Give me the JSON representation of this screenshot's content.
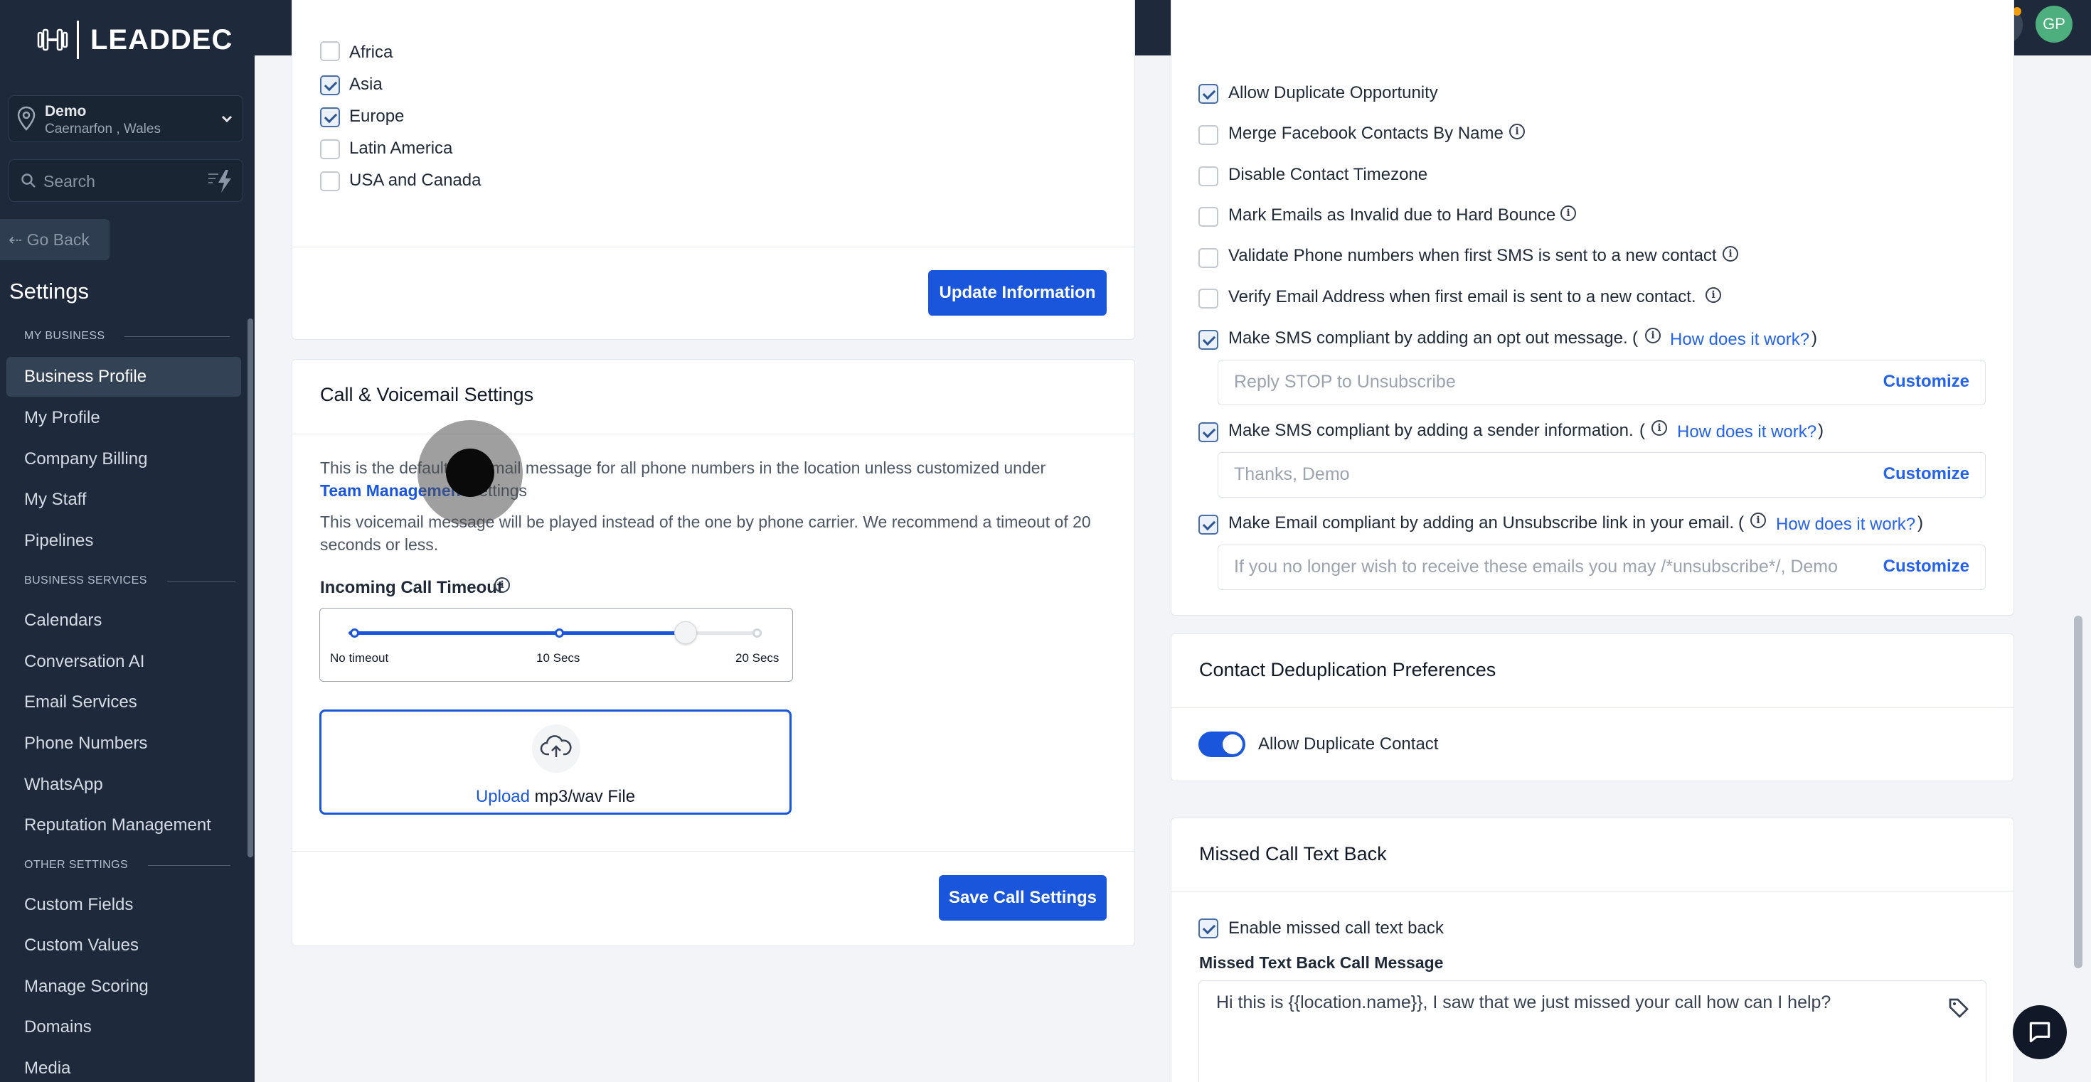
{
  "brand": {
    "name": "LEADDEC"
  },
  "location": {
    "name": "Demo",
    "city": "Caernarfon , Wales"
  },
  "search": {
    "placeholder": "Search"
  },
  "nav": {
    "go_back": "⇠ Go Back",
    "settings_title": "Settings",
    "sections": [
      {
        "label": "MY BUSINESS",
        "items": [
          "Business Profile",
          "My Profile",
          "Company Billing",
          "My Staff",
          "Pipelines"
        ]
      },
      {
        "label": "BUSINESS SERVICES",
        "items": [
          "Calendars",
          "Conversation AI",
          "Email Services",
          "Phone Numbers",
          "WhatsApp",
          "Reputation Management"
        ]
      },
      {
        "label": "OTHER SETTINGS",
        "items": [
          "Custom Fields",
          "Custom Values",
          "Manage Scoring",
          "Domains",
          "Media"
        ]
      }
    ],
    "active_item": "Business Profile"
  },
  "user": {
    "initials": "GP"
  },
  "regions": {
    "items": [
      {
        "label": "Africa",
        "checked": false
      },
      {
        "label": "Asia",
        "checked": true
      },
      {
        "label": "Europe",
        "checked": true
      },
      {
        "label": "Latin America",
        "checked": false
      },
      {
        "label": "USA and Canada",
        "checked": false
      }
    ],
    "update_button": "Update Information"
  },
  "call_settings": {
    "title": "Call & Voicemail Settings",
    "para1_text": "This is the default voicemail message for all phone numbers in the location unless customized under",
    "para1_link": "Team Management",
    "para1_tail": " settings",
    "para2": "This voicemail message will be played instead of the one by phone carrier. We recommend a timeout of 20 seconds or less.",
    "timeout_label": "Incoming Call Timeout",
    "slider": {
      "labels": [
        "No timeout",
        "10 Secs",
        "20 Secs"
      ],
      "value_fraction": 0.82
    },
    "upload_link": "Upload",
    "upload_text": " mp3/wav File",
    "save_button": "Save Call Settings"
  },
  "general_options": {
    "items": [
      {
        "label": "Allow Duplicate Opportunity",
        "checked": true,
        "info": false
      },
      {
        "label": "Merge Facebook Contacts By Name",
        "checked": false,
        "info": true
      },
      {
        "label": "Disable Contact Timezone",
        "checked": false,
        "info": false
      },
      {
        "label": "Mark Emails as Invalid due to Hard Bounce",
        "checked": false,
        "info": true
      },
      {
        "label": "Validate Phone numbers when first SMS is sent to a new contact",
        "checked": false,
        "info": true
      },
      {
        "label": "Verify Email Address when first email is sent to a new contact.",
        "checked": false,
        "info": true
      }
    ],
    "compliance": [
      {
        "label": "Make SMS compliant by adding an opt out message.",
        "checked": true,
        "how": "How does it work?",
        "placeholder": "Reply STOP to Unsubscribe",
        "customize": "Customize"
      },
      {
        "label": "Make SMS compliant by adding a sender information.",
        "checked": true,
        "how": "How does it work?",
        "placeholder": "Thanks, Demo",
        "customize": "Customize"
      },
      {
        "label": "Make Email compliant by adding an Unsubscribe link in your email.",
        "checked": true,
        "how": "How does it work?",
        "placeholder": "If you no longer wish to receive these emails you may /*unsubscribe*/, Demo",
        "customize": "Customize"
      }
    ]
  },
  "dedup": {
    "title": "Contact Deduplication Preferences",
    "toggle_label": "Allow Duplicate Contact",
    "toggle_on": true
  },
  "missed_call": {
    "title": "Missed Call Text Back",
    "enable_label": "Enable missed call text back",
    "enable_checked": true,
    "message_label": "Missed Text Back Call Message",
    "message": "Hi this is {{location.name}}, I saw that we just missed your call how can I help?"
  },
  "colors": {
    "sidebar": "#1e2a3b",
    "primary": "#1a56db",
    "link": "#2563eb"
  }
}
